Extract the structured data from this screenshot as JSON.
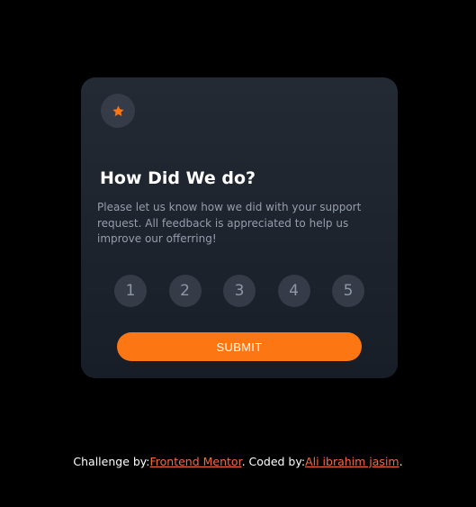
{
  "card": {
    "title": "How Did We do?",
    "description": "Please let us know how we did with your support request. All feedback is appreciated to help us improve our offerring!",
    "ratings": [
      "1",
      "2",
      "3",
      "4",
      "5"
    ],
    "submit_label": "SUBMIT",
    "icon": "star-icon"
  },
  "attribution": {
    "challenge_prefix": "Challenge by:",
    "challenge_link": "Frontend Mentor",
    "coded_prefix": ". Coded by:",
    "coded_link": "Ali ibrahim jasim",
    "suffix": "."
  },
  "colors": {
    "accent": "#fc7614",
    "background": "#000000",
    "card": "#20262f",
    "circle": "#353c47",
    "link": "#f26b43"
  }
}
